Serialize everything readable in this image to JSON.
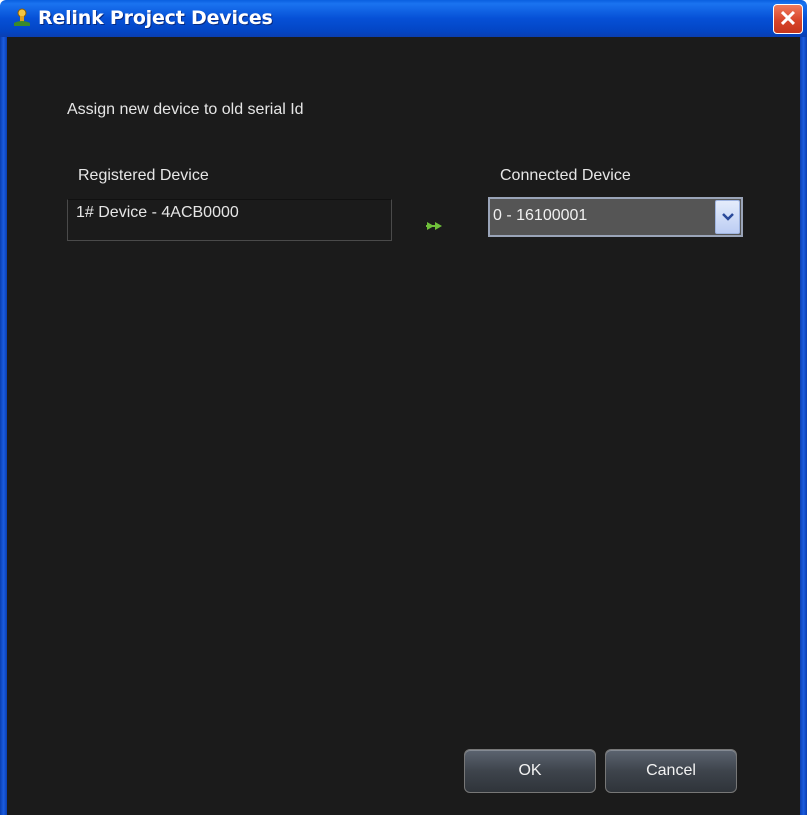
{
  "window": {
    "title": "Relink Project Devices",
    "close_symbol": "✕"
  },
  "dialog": {
    "prompt": "Assign new device to old serial Id",
    "registered_label": "Registered Device",
    "registered_value": "1# Device - 4ACB0000",
    "connected_label": "Connected Device",
    "connected_value": "0 - 16100001"
  },
  "buttons": {
    "ok": "OK",
    "cancel": "Cancel"
  },
  "icons": {
    "app": "relink-app-icon",
    "arrow": "double-arrow-right-icon",
    "dropdown": "chevron-down-icon",
    "close": "close-icon"
  },
  "colors": {
    "titlebar": "#0650d6",
    "client_bg": "#1b1b1b",
    "close": "#d8452a",
    "arrow": "#6fbf3a"
  }
}
